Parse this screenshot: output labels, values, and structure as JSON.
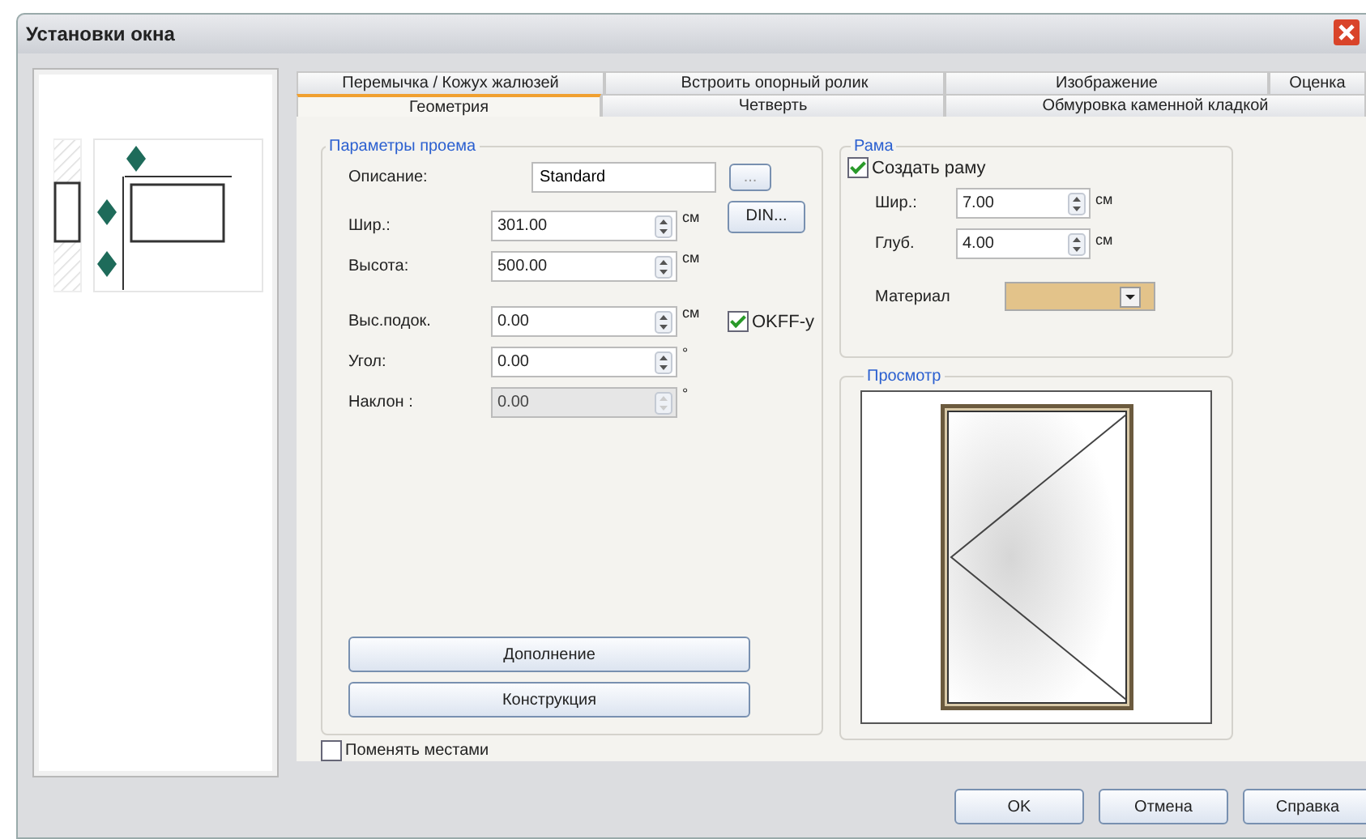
{
  "window": {
    "title": "Установки окна"
  },
  "tab_rows": [
    [
      {
        "label": "Перемычка / Кожух жалюзей",
        "selected": false
      },
      {
        "label": "Встроить опорный ролик",
        "selected": false
      },
      {
        "label": "Изображение",
        "selected": false
      },
      {
        "label": "Оценка",
        "selected": false
      }
    ],
    [
      {
        "label": "Геометрия",
        "selected": true
      },
      {
        "label": "Четверть",
        "selected": false
      },
      {
        "label": "Обмуровка каменной кладкой",
        "selected": false
      }
    ]
  ],
  "opening": {
    "title": "Параметры проема",
    "description": {
      "label": "Описание:",
      "value": "Standard",
      "button": "..."
    },
    "din_button": "DIN...",
    "fields": [
      {
        "label": "Шир.:",
        "value": "301.00",
        "unit": "см",
        "disabled": false
      },
      {
        "label": "Высота:",
        "value": "500.00",
        "unit": "см",
        "disabled": false
      },
      {
        "label": "Выс.подок.",
        "value": "0.00",
        "unit": "см",
        "disabled": false
      },
      {
        "label": "Угол:",
        "value": "0.00",
        "unit": "°",
        "disabled": false
      },
      {
        "label": "Наклон :",
        "value": "0.00",
        "unit": "°",
        "disabled": true
      }
    ],
    "okff": {
      "label": "OKFF-y",
      "checked": true
    },
    "buttons": [
      "Дополнение",
      "Конструкция"
    ]
  },
  "swap": {
    "label": "Поменять местами",
    "checked": false
  },
  "frame": {
    "title": "Рама",
    "create": {
      "label": "Создать раму",
      "checked": true
    },
    "fields": [
      {
        "label": "Шир.:",
        "value": "7.00",
        "unit": "см",
        "disabled": false
      },
      {
        "label": "Глуб.",
        "value": "4.00",
        "unit": "см",
        "disabled": false
      }
    ],
    "material": {
      "label": "Материал",
      "color": "#e3c38a"
    }
  },
  "preview": {
    "title": "Просмотр"
  },
  "footer_buttons": [
    "OK",
    "Отмена",
    "Справка"
  ]
}
